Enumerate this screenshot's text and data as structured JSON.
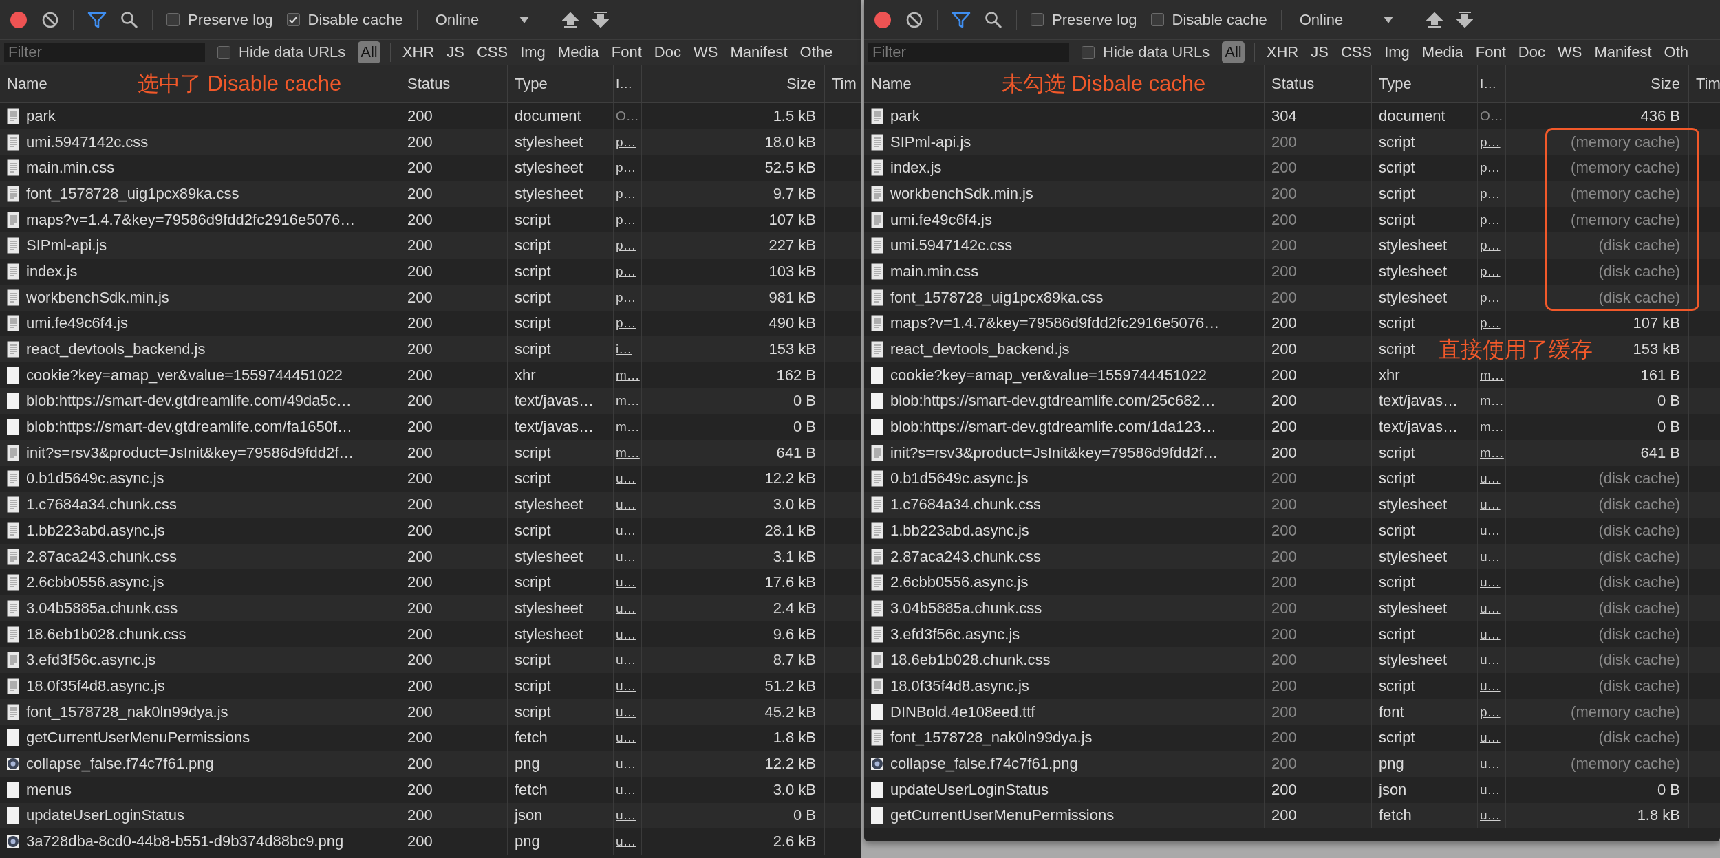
{
  "panels": [
    {
      "toolbar": {
        "preserve_log": {
          "label": "Preserve log",
          "checked": false
        },
        "disable_cache": {
          "label": "Disable cache",
          "checked": true
        },
        "throttle": "Online"
      },
      "filter": {
        "placeholder": "Filter",
        "hide_data_urls": {
          "label": "Hide data URLs",
          "checked": false
        },
        "types": [
          {
            "label": "All",
            "selected": true
          },
          {
            "label": "XHR",
            "selected": false
          },
          {
            "label": "JS",
            "selected": false
          },
          {
            "label": "CSS",
            "selected": false
          },
          {
            "label": "Img",
            "selected": false
          },
          {
            "label": "Media",
            "selected": false
          },
          {
            "label": "Font",
            "selected": false
          },
          {
            "label": "Doc",
            "selected": false
          },
          {
            "label": "WS",
            "selected": false
          },
          {
            "label": "Manifest",
            "selected": false
          },
          {
            "label": "Othe",
            "selected": false
          }
        ]
      },
      "columns": [
        "Name",
        "Status",
        "Type",
        "I…",
        "Size",
        "Tim"
      ],
      "note": "选中了 Disable cache",
      "rows": [
        {
          "name": "park",
          "status": "200",
          "type": "document",
          "initiator": "O…",
          "link": false,
          "size": "1.5 kB",
          "kind": "doc",
          "cached": false
        },
        {
          "name": "umi.5947142c.css",
          "status": "200",
          "type": "stylesheet",
          "initiator": "p…",
          "link": true,
          "size": "18.0 kB",
          "kind": "doc",
          "cached": false
        },
        {
          "name": "main.min.css",
          "status": "200",
          "type": "stylesheet",
          "initiator": "p…",
          "link": true,
          "size": "52.5 kB",
          "kind": "doc",
          "cached": false
        },
        {
          "name": "font_1578728_uig1pcx89ka.css",
          "status": "200",
          "type": "stylesheet",
          "initiator": "p…",
          "link": true,
          "size": "9.7 kB",
          "kind": "doc",
          "cached": false
        },
        {
          "name": "maps?v=1.4.7&key=79586d9fdd2fc2916e5076…",
          "status": "200",
          "type": "script",
          "initiator": "p…",
          "link": true,
          "size": "107 kB",
          "kind": "doc",
          "cached": false
        },
        {
          "name": "SIPml-api.js",
          "status": "200",
          "type": "script",
          "initiator": "p…",
          "link": true,
          "size": "227 kB",
          "kind": "doc",
          "cached": false
        },
        {
          "name": "index.js",
          "status": "200",
          "type": "script",
          "initiator": "p…",
          "link": true,
          "size": "103 kB",
          "kind": "doc",
          "cached": false
        },
        {
          "name": "workbenchSdk.min.js",
          "status": "200",
          "type": "script",
          "initiator": "p…",
          "link": true,
          "size": "981 kB",
          "kind": "doc",
          "cached": false
        },
        {
          "name": "umi.fe49c6f4.js",
          "status": "200",
          "type": "script",
          "initiator": "p…",
          "link": true,
          "size": "490 kB",
          "kind": "doc",
          "cached": false
        },
        {
          "name": "react_devtools_backend.js",
          "status": "200",
          "type": "script",
          "initiator": "i…",
          "link": true,
          "size": "153 kB",
          "kind": "doc",
          "cached": false
        },
        {
          "name": "cookie?key=amap_ver&value=1559744451022",
          "status": "200",
          "type": "xhr",
          "initiator": "m…",
          "link": true,
          "size": "162 B",
          "kind": "plain",
          "cached": false
        },
        {
          "name": "blob:https://smart-dev.gtdreamlife.com/49da5c…",
          "status": "200",
          "type": "text/javas…",
          "initiator": "m…",
          "link": true,
          "size": "0 B",
          "kind": "plain",
          "cached": false
        },
        {
          "name": "blob:https://smart-dev.gtdreamlife.com/fa1650f…",
          "status": "200",
          "type": "text/javas…",
          "initiator": "m…",
          "link": true,
          "size": "0 B",
          "kind": "plain",
          "cached": false
        },
        {
          "name": "init?s=rsv3&product=JsInit&key=79586d9fdd2f…",
          "status": "200",
          "type": "script",
          "initiator": "m…",
          "link": true,
          "size": "641 B",
          "kind": "doc",
          "cached": false
        },
        {
          "name": "0.b1d5649c.async.js",
          "status": "200",
          "type": "script",
          "initiator": "u…",
          "link": true,
          "size": "12.2 kB",
          "kind": "doc",
          "cached": false
        },
        {
          "name": "1.c7684a34.chunk.css",
          "status": "200",
          "type": "stylesheet",
          "initiator": "u…",
          "link": true,
          "size": "3.0 kB",
          "kind": "doc",
          "cached": false
        },
        {
          "name": "1.bb223abd.async.js",
          "status": "200",
          "type": "script",
          "initiator": "u…",
          "link": true,
          "size": "28.1 kB",
          "kind": "doc",
          "cached": false
        },
        {
          "name": "2.87aca243.chunk.css",
          "status": "200",
          "type": "stylesheet",
          "initiator": "u…",
          "link": true,
          "size": "3.1 kB",
          "kind": "doc",
          "cached": false
        },
        {
          "name": "2.6cbb0556.async.js",
          "status": "200",
          "type": "script",
          "initiator": "u…",
          "link": true,
          "size": "17.6 kB",
          "kind": "doc",
          "cached": false
        },
        {
          "name": "3.04b5885a.chunk.css",
          "status": "200",
          "type": "stylesheet",
          "initiator": "u…",
          "link": true,
          "size": "2.4 kB",
          "kind": "doc",
          "cached": false
        },
        {
          "name": "18.6eb1b028.chunk.css",
          "status": "200",
          "type": "stylesheet",
          "initiator": "u…",
          "link": true,
          "size": "9.6 kB",
          "kind": "doc",
          "cached": false
        },
        {
          "name": "3.efd3f56c.async.js",
          "status": "200",
          "type": "script",
          "initiator": "u…",
          "link": true,
          "size": "8.7 kB",
          "kind": "doc",
          "cached": false
        },
        {
          "name": "18.0f35f4d8.async.js",
          "status": "200",
          "type": "script",
          "initiator": "u…",
          "link": true,
          "size": "51.2 kB",
          "kind": "doc",
          "cached": false
        },
        {
          "name": "font_1578728_nak0ln99dya.js",
          "status": "200",
          "type": "script",
          "initiator": "u…",
          "link": true,
          "size": "45.2 kB",
          "kind": "doc",
          "cached": false
        },
        {
          "name": "getCurrentUserMenuPermissions",
          "status": "200",
          "type": "fetch",
          "initiator": "u…",
          "link": true,
          "size": "1.8 kB",
          "kind": "plain",
          "cached": false
        },
        {
          "name": "collapse_false.f74c7f61.png",
          "status": "200",
          "type": "png",
          "initiator": "u…",
          "link": true,
          "size": "12.2 kB",
          "kind": "image",
          "cached": false
        },
        {
          "name": "menus",
          "status": "200",
          "type": "fetch",
          "initiator": "u…",
          "link": true,
          "size": "3.0 kB",
          "kind": "plain",
          "cached": false
        },
        {
          "name": "updateUserLoginStatus",
          "status": "200",
          "type": "json",
          "initiator": "u…",
          "link": true,
          "size": "0 B",
          "kind": "plain",
          "cached": false
        },
        {
          "name": "3a728dba-8cd0-44b8-b551-d9b374d88bc9.png",
          "status": "200",
          "type": "png",
          "initiator": "u…",
          "link": true,
          "size": "2.6 kB",
          "kind": "image",
          "cached": false
        }
      ]
    },
    {
      "toolbar": {
        "preserve_log": {
          "label": "Preserve log",
          "checked": false
        },
        "disable_cache": {
          "label": "Disable cache",
          "checked": false
        },
        "throttle": "Online"
      },
      "filter": {
        "placeholder": "Filter",
        "hide_data_urls": {
          "label": "Hide data URLs",
          "checked": false
        },
        "types": [
          {
            "label": "All",
            "selected": true
          },
          {
            "label": "XHR",
            "selected": false
          },
          {
            "label": "JS",
            "selected": false
          },
          {
            "label": "CSS",
            "selected": false
          },
          {
            "label": "Img",
            "selected": false
          },
          {
            "label": "Media",
            "selected": false
          },
          {
            "label": "Font",
            "selected": false
          },
          {
            "label": "Doc",
            "selected": false
          },
          {
            "label": "WS",
            "selected": false
          },
          {
            "label": "Manifest",
            "selected": false
          },
          {
            "label": "Oth",
            "selected": false
          }
        ]
      },
      "columns": [
        "Name",
        "Status",
        "Type",
        "I…",
        "Size",
        "Tim"
      ],
      "note": "未勾选 Disbale cache",
      "callout": "直接使用了缓存",
      "rows": [
        {
          "name": "park",
          "status": "304",
          "type": "document",
          "initiator": "O…",
          "link": false,
          "size": "436 B",
          "kind": "doc",
          "cached": false,
          "boxed": false
        },
        {
          "name": "SIPml-api.js",
          "status": "200",
          "type": "script",
          "initiator": "p…",
          "link": true,
          "size": "(memory cache)",
          "kind": "doc",
          "cached": true,
          "boxed": true
        },
        {
          "name": "index.js",
          "status": "200",
          "type": "script",
          "initiator": "p…",
          "link": true,
          "size": "(memory cache)",
          "kind": "doc",
          "cached": true,
          "boxed": true
        },
        {
          "name": "workbenchSdk.min.js",
          "status": "200",
          "type": "script",
          "initiator": "p…",
          "link": true,
          "size": "(memory cache)",
          "kind": "doc",
          "cached": true,
          "boxed": true
        },
        {
          "name": "umi.fe49c6f4.js",
          "status": "200",
          "type": "script",
          "initiator": "p…",
          "link": true,
          "size": "(memory cache)",
          "kind": "doc",
          "cached": true,
          "boxed": true
        },
        {
          "name": "umi.5947142c.css",
          "status": "200",
          "type": "stylesheet",
          "initiator": "p…",
          "link": true,
          "size": "(disk cache)",
          "kind": "doc",
          "cached": true,
          "boxed": true
        },
        {
          "name": "main.min.css",
          "status": "200",
          "type": "stylesheet",
          "initiator": "p…",
          "link": true,
          "size": "(disk cache)",
          "kind": "doc",
          "cached": true,
          "boxed": true
        },
        {
          "name": "font_1578728_uig1pcx89ka.css",
          "status": "200",
          "type": "stylesheet",
          "initiator": "p…",
          "link": true,
          "size": "(disk cache)",
          "kind": "doc",
          "cached": true,
          "boxed": true
        },
        {
          "name": "maps?v=1.4.7&key=79586d9fdd2fc2916e5076…",
          "status": "200",
          "type": "script",
          "initiator": "p…",
          "link": true,
          "size": "107 kB",
          "kind": "doc",
          "cached": false,
          "boxed": false
        },
        {
          "name": "react_devtools_backend.js",
          "status": "200",
          "type": "script",
          "size": "153 kB",
          "kind": "doc",
          "cached": false,
          "boxed": false
        },
        {
          "name": "cookie?key=amap_ver&value=1559744451022",
          "status": "200",
          "type": "xhr",
          "initiator": "m…",
          "link": true,
          "size": "161 B",
          "kind": "plain",
          "cached": false,
          "boxed": false
        },
        {
          "name": "blob:https://smart-dev.gtdreamlife.com/25c682…",
          "status": "200",
          "type": "text/javas…",
          "initiator": "m…",
          "link": true,
          "size": "0 B",
          "kind": "plain",
          "cached": false,
          "boxed": false
        },
        {
          "name": "blob:https://smart-dev.gtdreamlife.com/1da123…",
          "status": "200",
          "type": "text/javas…",
          "initiator": "m…",
          "link": true,
          "size": "0 B",
          "kind": "plain",
          "cached": false,
          "boxed": false
        },
        {
          "name": "init?s=rsv3&product=JsInit&key=79586d9fdd2f…",
          "status": "200",
          "type": "script",
          "initiator": "m…",
          "link": true,
          "size": "641 B",
          "kind": "doc",
          "cached": false,
          "boxed": false
        },
        {
          "name": "0.b1d5649c.async.js",
          "status": "200",
          "type": "script",
          "initiator": "u…",
          "link": true,
          "size": "(disk cache)",
          "kind": "doc",
          "cached": true,
          "boxed": false
        },
        {
          "name": "1.c7684a34.chunk.css",
          "status": "200",
          "type": "stylesheet",
          "initiator": "u…",
          "link": true,
          "size": "(disk cache)",
          "kind": "doc",
          "cached": true,
          "boxed": false
        },
        {
          "name": "1.bb223abd.async.js",
          "status": "200",
          "type": "script",
          "initiator": "u…",
          "link": true,
          "size": "(disk cache)",
          "kind": "doc",
          "cached": true,
          "boxed": false
        },
        {
          "name": "2.87aca243.chunk.css",
          "status": "200",
          "type": "stylesheet",
          "initiator": "u…",
          "link": true,
          "size": "(disk cache)",
          "kind": "doc",
          "cached": true,
          "boxed": false
        },
        {
          "name": "2.6cbb0556.async.js",
          "status": "200",
          "type": "script",
          "initiator": "u…",
          "link": true,
          "size": "(disk cache)",
          "kind": "doc",
          "cached": true,
          "boxed": false
        },
        {
          "name": "3.04b5885a.chunk.css",
          "status": "200",
          "type": "stylesheet",
          "initiator": "u…",
          "link": true,
          "size": "(disk cache)",
          "kind": "doc",
          "cached": true,
          "boxed": false
        },
        {
          "name": "3.efd3f56c.async.js",
          "status": "200",
          "type": "script",
          "initiator": "u…",
          "link": true,
          "size": "(disk cache)",
          "kind": "doc",
          "cached": true,
          "boxed": false
        },
        {
          "name": "18.6eb1b028.chunk.css",
          "status": "200",
          "type": "stylesheet",
          "initiator": "u…",
          "link": true,
          "size": "(disk cache)",
          "kind": "doc",
          "cached": true,
          "boxed": false
        },
        {
          "name": "18.0f35f4d8.async.js",
          "status": "200",
          "type": "script",
          "initiator": "u…",
          "link": true,
          "size": "(disk cache)",
          "kind": "doc",
          "cached": true,
          "boxed": false
        },
        {
          "name": "DINBold.4e108eed.ttf",
          "status": "200",
          "type": "font",
          "initiator": "p…",
          "link": true,
          "size": "(memory cache)",
          "kind": "plain",
          "cached": true,
          "boxed": false
        },
        {
          "name": "font_1578728_nak0ln99dya.js",
          "status": "200",
          "type": "script",
          "initiator": "u…",
          "link": true,
          "size": "(disk cache)",
          "kind": "doc",
          "cached": true,
          "boxed": false
        },
        {
          "name": "collapse_false.f74c7f61.png",
          "status": "200",
          "type": "png",
          "initiator": "u…",
          "link": true,
          "size": "(memory cache)",
          "kind": "image",
          "cached": true,
          "boxed": false
        },
        {
          "name": "updateUserLoginStatus",
          "status": "200",
          "type": "json",
          "initiator": "u…",
          "link": true,
          "size": "0 B",
          "kind": "plain",
          "cached": false,
          "boxed": false
        },
        {
          "name": "getCurrentUserMenuPermissions",
          "status": "200",
          "type": "fetch",
          "initiator": "u…",
          "link": true,
          "size": "1.8 kB",
          "kind": "plain",
          "cached": false,
          "boxed": false
        }
      ]
    }
  ]
}
